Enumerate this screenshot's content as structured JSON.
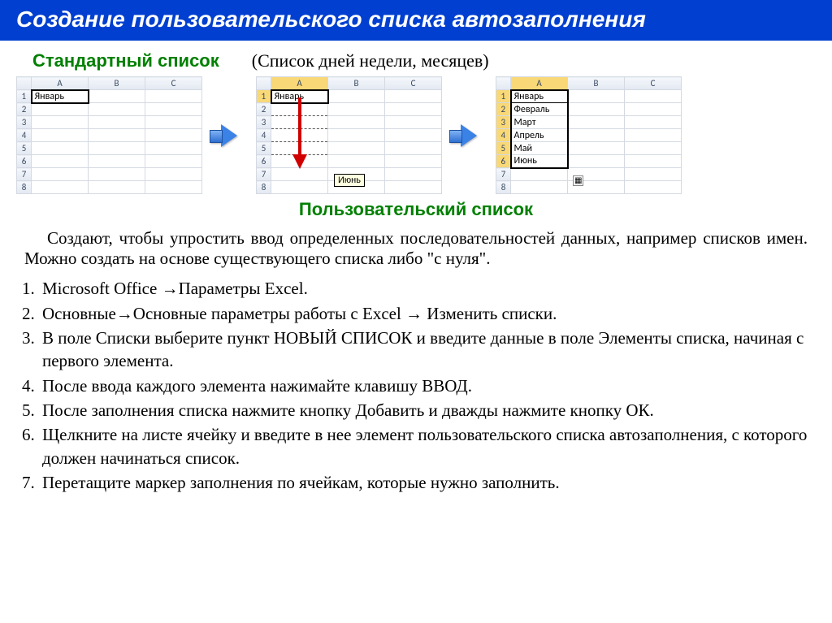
{
  "title": "Создание пользовательского списка автозаполнения",
  "standard_title": "Стандартный список",
  "standard_sub": "(Список дней недели, месяцев)",
  "user_list_title": "Пользовательский  список",
  "columns": [
    "A",
    "B",
    "C"
  ],
  "rows8": [
    "1",
    "2",
    "3",
    "4",
    "5",
    "6",
    "7",
    "8"
  ],
  "grid1_cell": "Январь",
  "grid2_cell": "Январь",
  "tooltip": "Июнь",
  "months": [
    "Январь",
    "Февраль",
    "Март",
    "Апрель",
    "Май",
    "Июнь"
  ],
  "body_text": "Создают, чтобы упростить ввод определенных последовательностей данных, например списков имен.  Можно создать на основе существующего списка либо \"с нуля\".",
  "steps": [
    "Microsoft Office →Параметры Excel.",
    "Основные→Основные параметры работы с Excel → Изменить списки.",
    "В поле Списки выберите пункт НОВЫЙ СПИСОК и введите данные в поле Элементы списка, начиная с первого элемента.",
    "После ввода каждого элемента нажимайте клавишу ВВОД.",
    "После заполнения списка нажмите кнопку Добавить и дважды нажмите кнопку ОК.",
    "Щелкните на листе ячейку и введите в нее элемент пользовательского списка автозаполнения, с которого должен начинаться список.",
    "Перетащите маркер заполнения по ячейкам, которые нужно заполнить."
  ],
  "fill_icon": "▦"
}
